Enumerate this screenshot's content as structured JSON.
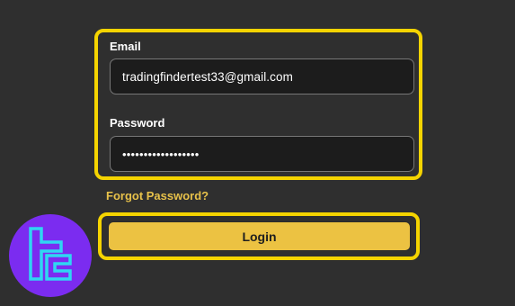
{
  "login_form": {
    "email_label": "Email",
    "email_value": "tradingfindertest33@gmail.com",
    "password_label": "Password",
    "password_value": "••••••••••••••••••",
    "forgot_password_label": "Forgot Password?",
    "login_button_label": "Login"
  },
  "logo": {
    "icon": "tc-brand-icon"
  },
  "colors": {
    "background": "#2f2f2f",
    "highlight_outline": "#f5d400",
    "accent_link": "#e7c14a",
    "button": "#ecc242",
    "logo_background": "#7b2cf0",
    "logo_glyph": "#2fd6f2"
  }
}
